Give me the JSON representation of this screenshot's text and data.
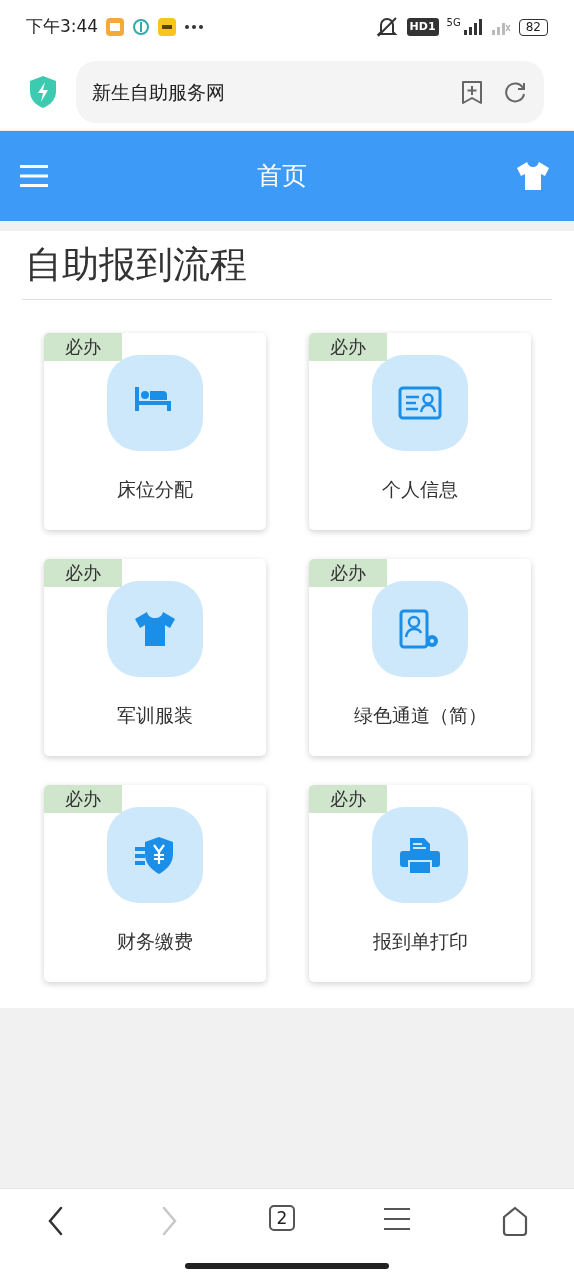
{
  "status_bar": {
    "time": "下午3:44",
    "network_badge": "HD1",
    "network_type": "5G",
    "battery": "82"
  },
  "browser": {
    "address": "新生自助服务网",
    "tab_count": "2",
    "forward_disabled": true
  },
  "header": {
    "title": "首页"
  },
  "section": {
    "title": "自助报到流程"
  },
  "tiles": [
    {
      "label": "床位分配",
      "badge": "必办",
      "kind": "bed"
    },
    {
      "label": "个人信息",
      "badge": "必办",
      "kind": "idcard"
    },
    {
      "label": "军训服装",
      "badge": "必办",
      "kind": "shirt"
    },
    {
      "label": "绿色通道（简）",
      "badge": "必办",
      "kind": "profile"
    },
    {
      "label": "财务缴费",
      "badge": "必办",
      "kind": "payment"
    },
    {
      "label": "报到单打印",
      "badge": "必办",
      "kind": "printer"
    }
  ]
}
